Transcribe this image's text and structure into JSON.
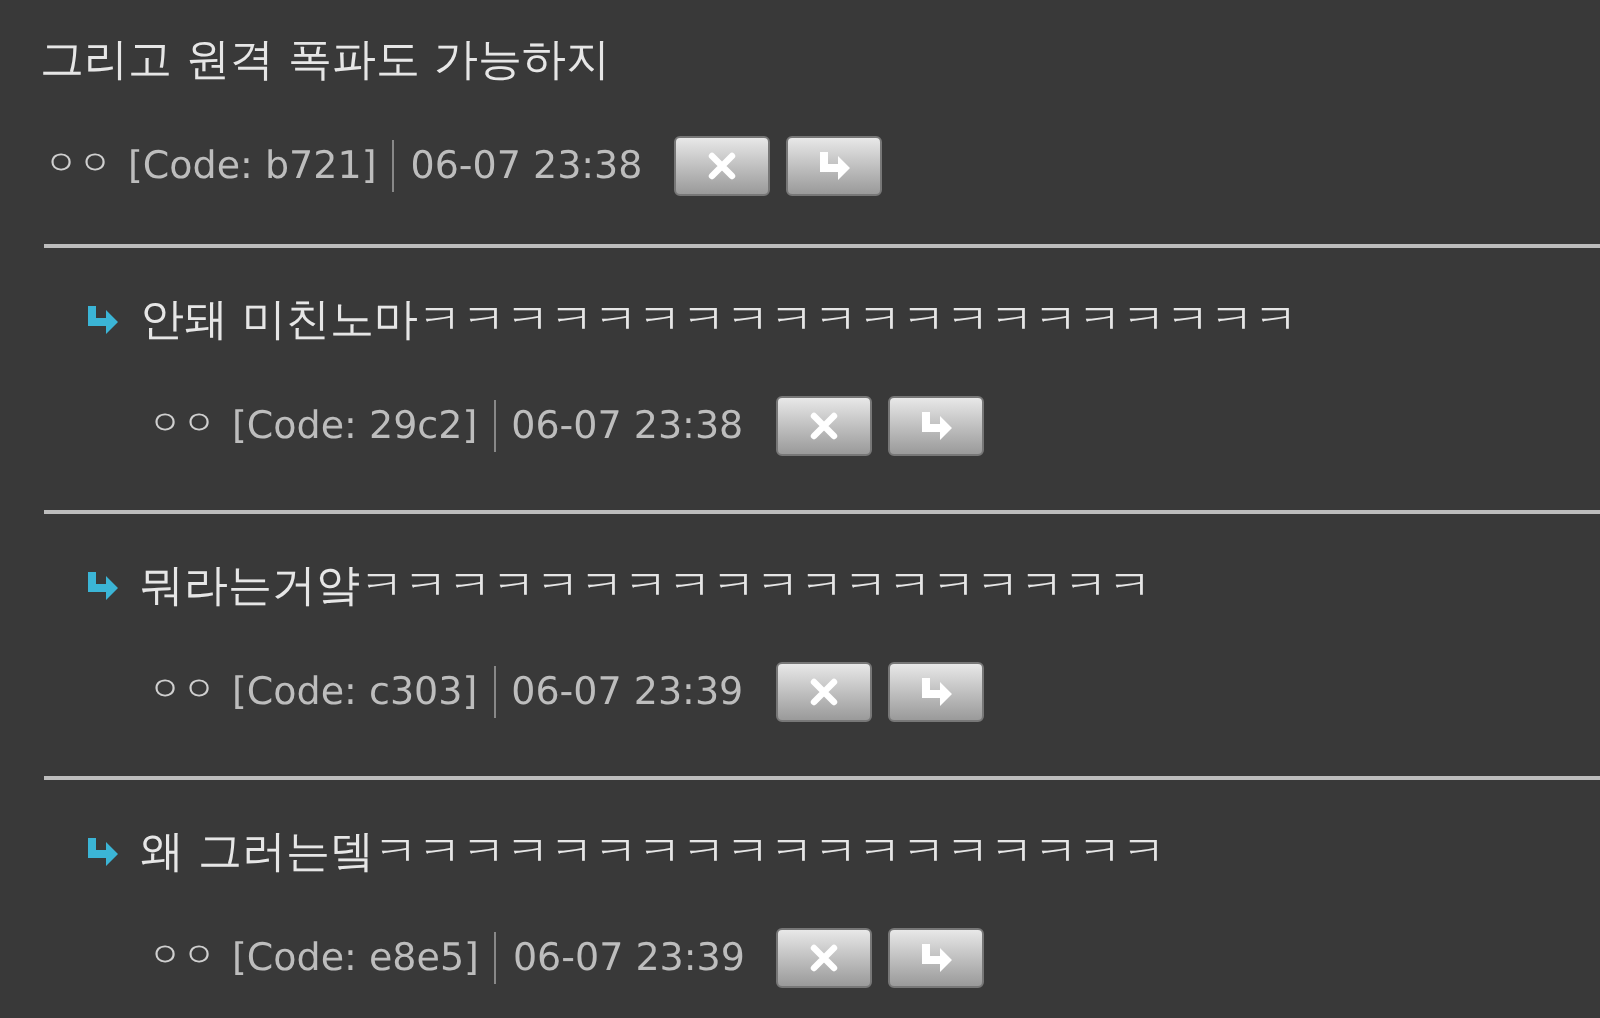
{
  "comments": [
    {
      "kind": "comment",
      "text": "그리고 원격 폭파도 가능하지",
      "author": "ㅇㅇ",
      "code": "[Code: b721]",
      "time": "06-07 23:38"
    },
    {
      "kind": "reply",
      "text": "안돼 미친노마ㅋㅋㅋㅋㅋㅋㅋㅋㅋㅋㅋㅋㅋㅋㅋㅋㅋㅋㅋㅋ",
      "author": "ㅇㅇ",
      "code": "[Code: 29c2]",
      "time": "06-07 23:38"
    },
    {
      "kind": "reply",
      "text": "뭐라는거얔ㅋㅋㅋㅋㅋㅋㅋㅋㅋㅋㅋㅋㅋㅋㅋㅋㅋㅋ",
      "author": "ㅇㅇ",
      "code": "[Code: c303]",
      "time": "06-07 23:39"
    },
    {
      "kind": "reply",
      "text": "왜 그러는뎈ㅋㅋㅋㅋㅋㅋㅋㅋㅋㅋㅋㅋㅋㅋㅋㅋㅋㅋ",
      "author": "ㅇㅇ",
      "code": "[Code: e8e5]",
      "time": "06-07 23:39"
    }
  ]
}
